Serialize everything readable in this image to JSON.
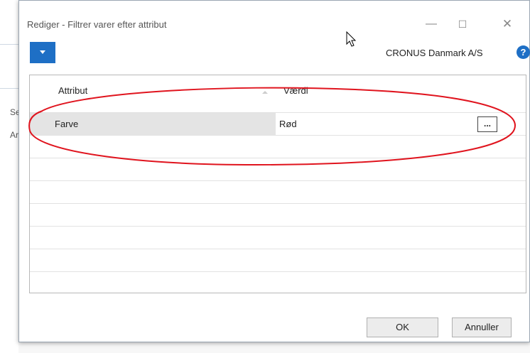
{
  "background": {
    "left_fragments": [
      "Se",
      "Ar"
    ]
  },
  "dialog": {
    "title": "Rediger - Filtrer varer efter attribut",
    "company": "CRONUS Danmark A/S",
    "help_icon_char": "?",
    "menu_icon": "chevron-down-icon"
  },
  "grid": {
    "columns": [
      "Attribut",
      "Værdi"
    ],
    "rows": [
      {
        "attribut": "Farve",
        "vaerdi": "Rød",
        "selected": true
      },
      {
        "attribut": "",
        "vaerdi": ""
      },
      {
        "attribut": "",
        "vaerdi": ""
      },
      {
        "attribut": "",
        "vaerdi": ""
      },
      {
        "attribut": "",
        "vaerdi": ""
      },
      {
        "attribut": "",
        "vaerdi": ""
      },
      {
        "attribut": "",
        "vaerdi": ""
      },
      {
        "attribut": "",
        "vaerdi": ""
      }
    ],
    "assist_label": "..."
  },
  "buttons": {
    "ok": "OK",
    "cancel": "Annuller"
  },
  "colors": {
    "accent": "#1e6fc5",
    "annotation": "#e0141e"
  }
}
